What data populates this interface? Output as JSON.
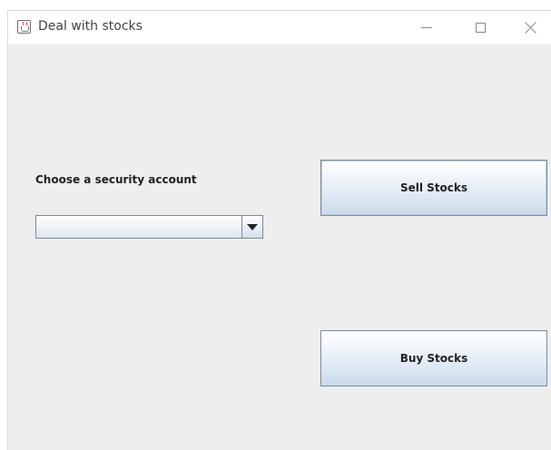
{
  "window": {
    "title": "Deal with stocks",
    "controls": {
      "minimize": "minimize-icon",
      "maximize": "maximize-icon",
      "close": "close-icon"
    }
  },
  "form": {
    "account_label": "Choose a security account",
    "account_select": {
      "selected": "",
      "options": []
    }
  },
  "actions": {
    "sell_label": "Sell Stocks",
    "buy_label": "Buy Stocks"
  },
  "colors": {
    "background": "#eeeeee",
    "titlebar": "#ffffff",
    "button_border": "#7a8a99",
    "button_gradient_top": "#ffffff",
    "button_gradient_bottom": "#c9d9ea"
  }
}
